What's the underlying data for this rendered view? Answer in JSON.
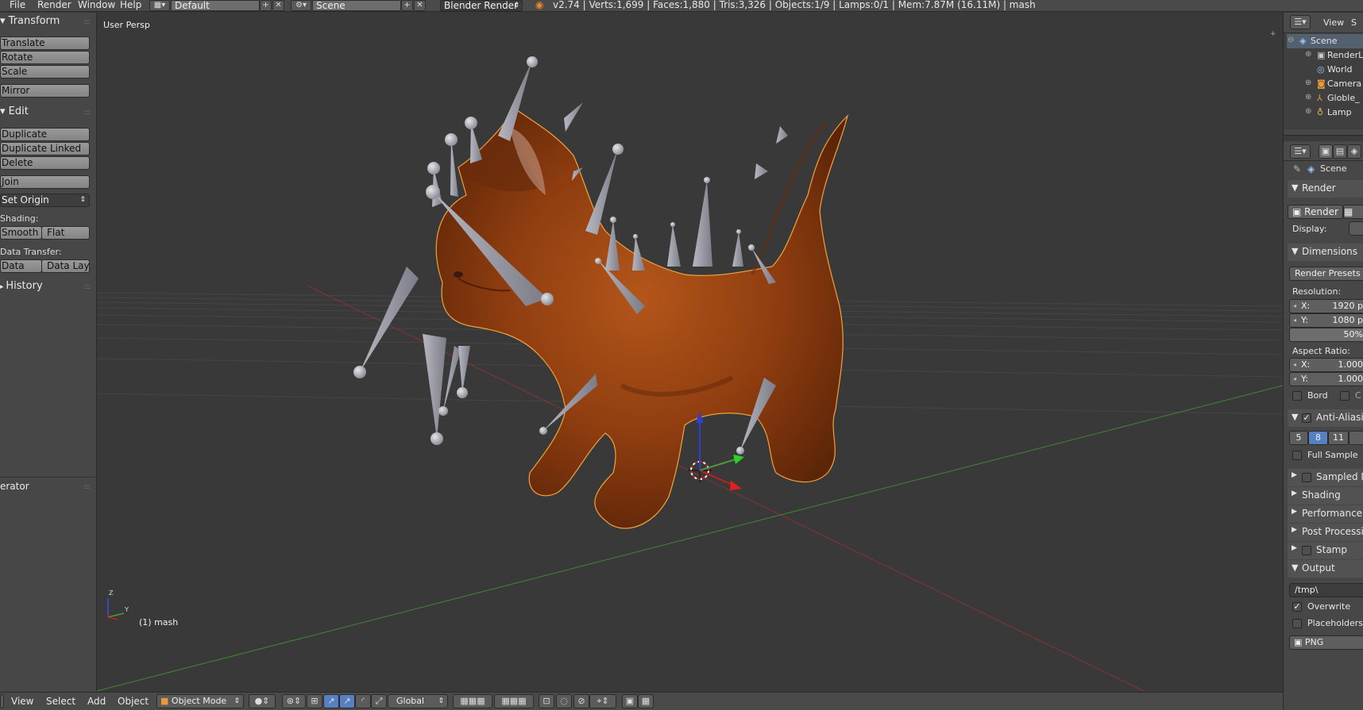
{
  "topbar": {
    "menus": [
      "File",
      "Render",
      "Window",
      "Help"
    ],
    "layout": "Default",
    "scene": "Scene",
    "engine": "Blender Render",
    "stats": "v2.74 | Verts:1,699 | Faces:1,880 | Tris:3,326 | Objects:1/9 | Lamps:0/1 | Mem:7.87M (16.11M) | mash"
  },
  "toolshelf": {
    "transform": "Transform",
    "translate": "Translate",
    "rotate": "Rotate",
    "scale": "Scale",
    "mirror": "Mirror",
    "edit": "Edit",
    "duplicate": "Duplicate",
    "duplicate_linked": "Duplicate Linked",
    "delete": "Delete",
    "join": "Join",
    "set_origin": "Set Origin",
    "shading_label": "Shading:",
    "smooth": "Smooth",
    "flat": "Flat",
    "data_transfer_label": "Data Transfer:",
    "data": "Data",
    "data_layout": "Data Layo",
    "history": "History",
    "operator": "erator"
  },
  "viewport": {
    "view_name": "User Persp",
    "object_label": "(1) mash",
    "axis_z": "Z",
    "axis_y": "Y"
  },
  "outliner": {
    "view": "View",
    "s": "S",
    "items": [
      "Scene",
      "RenderL",
      "World",
      "Camera",
      "Globle_",
      "Lamp"
    ]
  },
  "properties": {
    "context": "Scene",
    "render_panel": "Render",
    "render_btn": "Render",
    "display_label": "Display:",
    "dimensions": "Dimensions",
    "render_presets": "Render Presets",
    "resolution_label": "Resolution:",
    "res_x_label": "X:",
    "res_x_value": "1920 p",
    "res_y_label": "Y:",
    "res_y_value": "1080 p",
    "res_pct": "50%",
    "aspect_label": "Aspect Ratio:",
    "asp_x_label": "X:",
    "asp_x_value": "1.000",
    "asp_y_label": "Y:",
    "asp_y_value": "1.000",
    "border": "Bord",
    "crop": "C",
    "antialias": "Anti-Aliasi",
    "aa_5": "5",
    "aa_8": "8",
    "aa_11": "11",
    "full_sample": "Full Sample",
    "sampled": "Sampled M",
    "shading": "Shading",
    "performance": "Performance",
    "post_processing": "Post Processin",
    "stamp": "Stamp",
    "output": "Output",
    "output_path": "/tmp\\",
    "overwrite": "Overwrite",
    "placeholders": "Placeholders",
    "format": "PNG"
  },
  "bottombar": {
    "view": "View",
    "select": "Select",
    "add": "Add",
    "object": "Object",
    "mode": "Object Mode",
    "orientation": "Global"
  },
  "colors": {
    "accent_blue": "#5680c2",
    "selection_orange": "#f1a33a",
    "x_axis": "#9a3434",
    "y_axis": "#4e9a34",
    "z_axis": "#2f3fd0"
  }
}
